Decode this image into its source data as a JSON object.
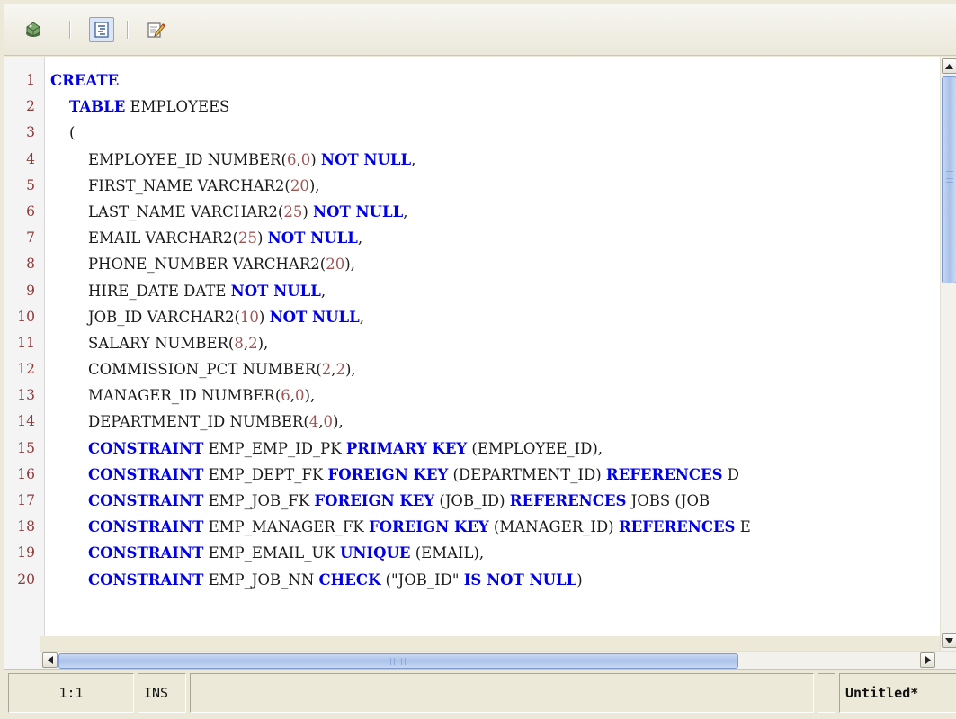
{
  "toolbar": {
    "buttons": [
      {
        "icon": "run-script-icon"
      },
      {
        "icon": "format-document-icon",
        "active": true
      },
      {
        "icon": "edit-document-icon"
      }
    ]
  },
  "editor": {
    "lines": [
      {
        "n": "1",
        "tokens": [
          {
            "t": "CREATE",
            "k": "kw"
          }
        ]
      },
      {
        "n": "2",
        "tokens": [
          {
            "t": "    "
          },
          {
            "t": "TABLE",
            "k": "kw"
          },
          {
            "t": " EMPLOYEES"
          }
        ]
      },
      {
        "n": "3",
        "tokens": [
          {
            "t": "    ("
          }
        ]
      },
      {
        "n": "4",
        "tokens": [
          {
            "t": "        EMPLOYEE_ID NUMBER("
          },
          {
            "t": "6",
            "k": "num"
          },
          {
            "t": ","
          },
          {
            "t": "0",
            "k": "num"
          },
          {
            "t": ") "
          },
          {
            "t": "NOT NULL",
            "k": "kw"
          },
          {
            "t": ","
          }
        ]
      },
      {
        "n": "5",
        "tokens": [
          {
            "t": "        FIRST_NAME VARCHAR2("
          },
          {
            "t": "20",
            "k": "num"
          },
          {
            "t": "),"
          }
        ]
      },
      {
        "n": "6",
        "tokens": [
          {
            "t": "        LAST_NAME VARCHAR2("
          },
          {
            "t": "25",
            "k": "num"
          },
          {
            "t": ") "
          },
          {
            "t": "NOT NULL",
            "k": "kw"
          },
          {
            "t": ","
          }
        ]
      },
      {
        "n": "7",
        "tokens": [
          {
            "t": "        EMAIL VARCHAR2("
          },
          {
            "t": "25",
            "k": "num"
          },
          {
            "t": ") "
          },
          {
            "t": "NOT NULL",
            "k": "kw"
          },
          {
            "t": ","
          }
        ]
      },
      {
        "n": "8",
        "tokens": [
          {
            "t": "        PHONE_NUMBER VARCHAR2("
          },
          {
            "t": "20",
            "k": "num"
          },
          {
            "t": "),"
          }
        ]
      },
      {
        "n": "9",
        "tokens": [
          {
            "t": "        HIRE_DATE DATE "
          },
          {
            "t": "NOT NULL",
            "k": "kw"
          },
          {
            "t": ","
          }
        ]
      },
      {
        "n": "10",
        "tokens": [
          {
            "t": "        JOB_ID VARCHAR2("
          },
          {
            "t": "10",
            "k": "num"
          },
          {
            "t": ") "
          },
          {
            "t": "NOT NULL",
            "k": "kw"
          },
          {
            "t": ","
          }
        ]
      },
      {
        "n": "11",
        "tokens": [
          {
            "t": "        SALARY NUMBER("
          },
          {
            "t": "8",
            "k": "num"
          },
          {
            "t": ","
          },
          {
            "t": "2",
            "k": "num"
          },
          {
            "t": "),"
          }
        ]
      },
      {
        "n": "12",
        "tokens": [
          {
            "t": "        COMMISSION_PCT NUMBER("
          },
          {
            "t": "2",
            "k": "num"
          },
          {
            "t": ","
          },
          {
            "t": "2",
            "k": "num"
          },
          {
            "t": "),"
          }
        ]
      },
      {
        "n": "13",
        "tokens": [
          {
            "t": "        MANAGER_ID NUMBER("
          },
          {
            "t": "6",
            "k": "num"
          },
          {
            "t": ","
          },
          {
            "t": "0",
            "k": "num"
          },
          {
            "t": "),"
          }
        ]
      },
      {
        "n": "14",
        "tokens": [
          {
            "t": "        DEPARTMENT_ID NUMBER("
          },
          {
            "t": "4",
            "k": "num"
          },
          {
            "t": ","
          },
          {
            "t": "0",
            "k": "num"
          },
          {
            "t": "),"
          }
        ]
      },
      {
        "n": "15",
        "tokens": [
          {
            "t": "        "
          },
          {
            "t": "CONSTRAINT",
            "k": "kw"
          },
          {
            "t": " EMP_EMP_ID_PK "
          },
          {
            "t": "PRIMARY KEY",
            "k": "kw"
          },
          {
            "t": " (EMPLOYEE_ID),"
          }
        ]
      },
      {
        "n": "16",
        "tokens": [
          {
            "t": "        "
          },
          {
            "t": "CONSTRAINT",
            "k": "kw"
          },
          {
            "t": " EMP_DEPT_FK "
          },
          {
            "t": "FOREIGN KEY",
            "k": "kw"
          },
          {
            "t": " (DEPARTMENT_ID) "
          },
          {
            "t": "REFERENCES",
            "k": "kw"
          },
          {
            "t": " D"
          }
        ]
      },
      {
        "n": "17",
        "tokens": [
          {
            "t": "        "
          },
          {
            "t": "CONSTRAINT",
            "k": "kw"
          },
          {
            "t": " EMP_JOB_FK "
          },
          {
            "t": "FOREIGN KEY",
            "k": "kw"
          },
          {
            "t": " (JOB_ID) "
          },
          {
            "t": "REFERENCES",
            "k": "kw"
          },
          {
            "t": " JOBS (JOB"
          }
        ]
      },
      {
        "n": "18",
        "tokens": [
          {
            "t": "        "
          },
          {
            "t": "CONSTRAINT",
            "k": "kw"
          },
          {
            "t": " EMP_MANAGER_FK "
          },
          {
            "t": "FOREIGN KEY",
            "k": "kw"
          },
          {
            "t": " (MANAGER_ID) "
          },
          {
            "t": "REFERENCES",
            "k": "kw"
          },
          {
            "t": " E"
          }
        ]
      },
      {
        "n": "19",
        "tokens": [
          {
            "t": "        "
          },
          {
            "t": "CONSTRAINT",
            "k": "kw"
          },
          {
            "t": " EMP_EMAIL_UK "
          },
          {
            "t": "UNIQUE",
            "k": "kw"
          },
          {
            "t": " (EMAIL),"
          }
        ]
      },
      {
        "n": "20",
        "tokens": [
          {
            "t": "        "
          },
          {
            "t": "CONSTRAINT",
            "k": "kw"
          },
          {
            "t": " EMP_JOB_NN "
          },
          {
            "t": "CHECK",
            "k": "kw"
          },
          {
            "t": " (\"JOB_ID\" "
          },
          {
            "t": "IS NOT NULL",
            "k": "kw"
          },
          {
            "t": ")"
          }
        ]
      }
    ]
  },
  "status": {
    "position": "1:1",
    "mode": "INS",
    "filename": "Untitled*"
  },
  "colors": {
    "keyword": "#0000e6",
    "number": "#a05555",
    "line_number": "#8b3a3a"
  }
}
